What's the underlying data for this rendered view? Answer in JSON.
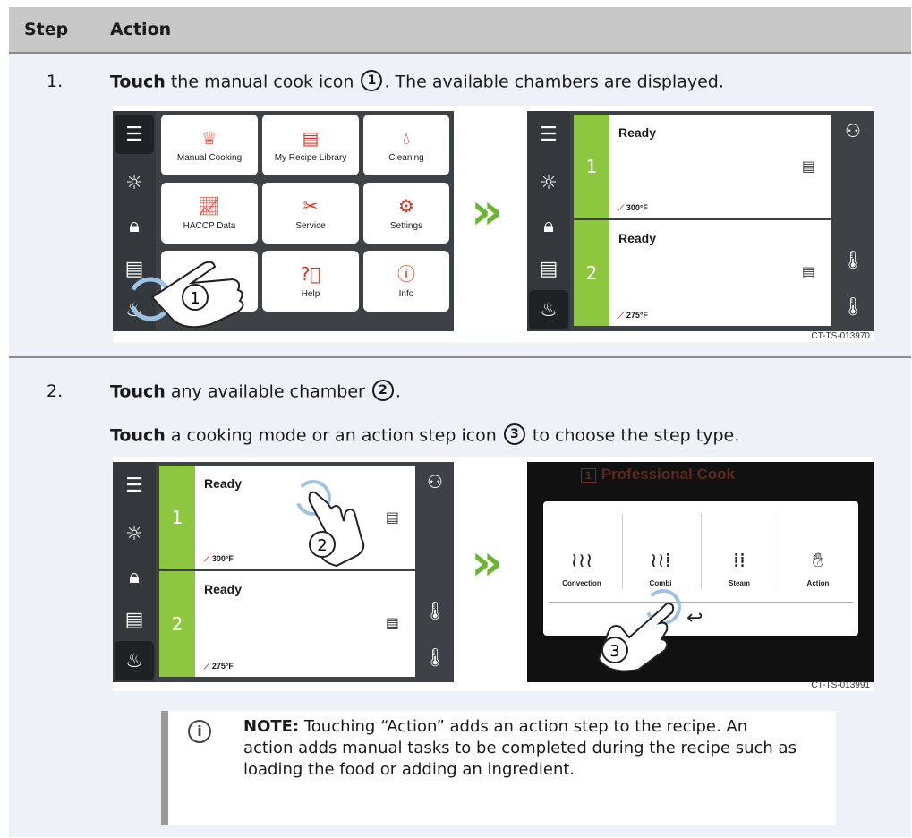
{
  "header": {
    "step": "Step",
    "action": "Action"
  },
  "steps": [
    {
      "number": "1.",
      "verb": "Touch",
      "text_a": " the manual cook icon ",
      "callout": "1",
      "text_b": ". The available chambers are displayed.",
      "image_code": "CT-TS-013970"
    },
    {
      "number": "2.",
      "line1_verb": "Touch",
      "line1_text_a": " any available chamber ",
      "line1_callout": "2",
      "line1_text_b": ".",
      "line2_verb": "Touch",
      "line2_text_a": " a cooking mode or an action step icon ",
      "line2_callout": "3",
      "line2_text_b": " to choose the step type.",
      "image_code": "CT-TS-013991"
    }
  ],
  "home_menu": {
    "tiles": [
      "Manual Cooking",
      "My Recipe Library",
      "Cleaning",
      "HACCP Data",
      "Service",
      "Settings",
      "",
      "Help",
      "Info"
    ],
    "callout": "1"
  },
  "chambers": [
    {
      "number": "1",
      "status": "Ready",
      "temp": "300°F"
    },
    {
      "number": "2",
      "status": "Ready",
      "temp": "275°F"
    }
  ],
  "mode_dialog": {
    "title": "Professional Cook",
    "title_number": "1",
    "modes": [
      "Convection",
      "Combi",
      "Steam",
      "Action"
    ],
    "callout_2": "2",
    "callout_3": "3"
  },
  "note": {
    "label": "NOTE:",
    "text": " Touching “Action” adds an action step to the recipe. An action adds manual tasks to be completed during the recipe such as loading the food or adding an ingredient."
  },
  "colors": {
    "accent_green": "#8dc63f",
    "icon_red": "#e0331f",
    "arrow_green": "#69b52f"
  }
}
